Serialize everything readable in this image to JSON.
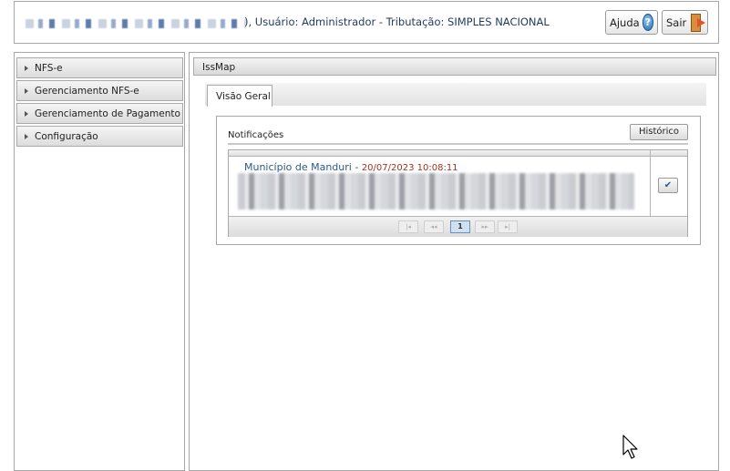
{
  "header": {
    "user_info": "), Usuário: Administrador - Tributação: SIMPLES NACIONAL",
    "help_label": "Ajuda",
    "exit_label": "Sair"
  },
  "sidebar": {
    "items": [
      {
        "label": "NFS-e"
      },
      {
        "label": "Gerenciamento NFS-e"
      },
      {
        "label": "Gerenciamento de Pagamento"
      },
      {
        "label": "Configuração"
      }
    ]
  },
  "main": {
    "title": "IssMap",
    "tabs": [
      {
        "label": "Visão Geral"
      }
    ],
    "notifications": {
      "label": "Notificações",
      "history_label": "Histórico",
      "rows": [
        {
          "source": "Município de Manduri",
          "timestamp": "20/07/2023 10:08:11"
        }
      ],
      "pager": {
        "first": "|◂",
        "prev": "◂◂",
        "current": "1",
        "next": "▸▸",
        "last": "▸|"
      }
    }
  },
  "colors": {
    "org_link": "#2a5a8a",
    "timestamp": "#a0331c",
    "header_text": "#1f3a5a"
  }
}
